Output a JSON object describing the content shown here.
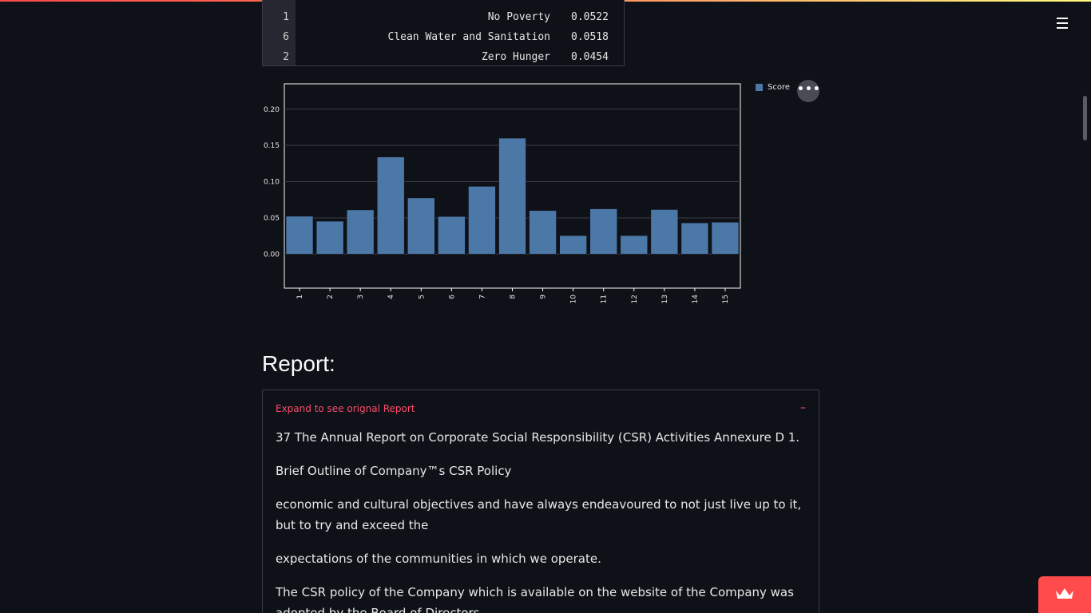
{
  "table": {
    "rows": [
      {
        "index": "1",
        "name": "No Poverty",
        "value": "0.0522"
      },
      {
        "index": "6",
        "name": "Clean Water and Sanitation",
        "value": "0.0518"
      },
      {
        "index": "2",
        "name": "Zero Hunger",
        "value": "0.0454"
      }
    ]
  },
  "chart": {
    "legend_label": "Score",
    "more_label": "•••"
  },
  "chart_data": {
    "type": "bar",
    "categories": [
      "1",
      "2",
      "3",
      "4",
      "5",
      "6",
      "7",
      "8",
      "9",
      "10",
      "11",
      "12",
      "13",
      "14",
      "15"
    ],
    "series": [
      {
        "name": "Score",
        "values": [
          0.0522,
          0.0454,
          0.061,
          0.134,
          0.0775,
          0.0518,
          0.0935,
          0.16,
          0.06,
          0.0255,
          0.0625,
          0.0255,
          0.0615,
          0.043,
          0.044
        ]
      }
    ],
    "yticks": [
      "0.00",
      "0.05",
      "0.10",
      "0.15",
      "0.20"
    ],
    "ylim": [
      -0.047,
      0.235
    ],
    "grid": true,
    "legend": "top-right",
    "bar_color": "#4c78a8"
  },
  "report": {
    "title": "Report:",
    "expander_label": "Expand to see orignal Report",
    "collapse_icon": "–",
    "paragraphs": [
      "37 The Annual Report on Corporate Social Responsibility (CSR) Activities Annexure D 1.",
      "Brief Outline of Company™s CSR Policy",
      "economic and cultural objectives and have always endeavoured to not just live up to it, but to try and exceed the",
      "expectations of the communities in which we operate.",
      "The CSR policy of the Company which is available on the website of the Company was adopted by the Board of Directors"
    ]
  }
}
